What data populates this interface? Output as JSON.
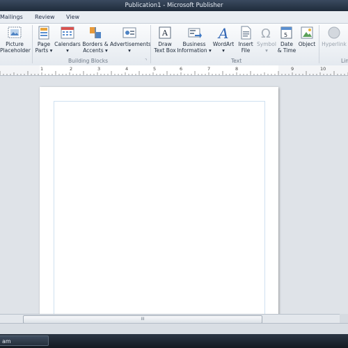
{
  "window": {
    "title": "Publication1 - Microsoft Publisher"
  },
  "tabs": [
    "Mailings",
    "Review",
    "View"
  ],
  "ribbon": {
    "picture_placeholder": [
      "Picture",
      "Placeholder"
    ],
    "page_parts": [
      "Page",
      "Parts ▾"
    ],
    "calendars": [
      "Calendars",
      "▾"
    ],
    "borders_accents": [
      "Borders &",
      "Accents ▾"
    ],
    "advertisements": [
      "Advertisements",
      "▾"
    ],
    "draw_text_box": [
      "Draw",
      "Text Box"
    ],
    "business_information": [
      "Business",
      "Information ▾"
    ],
    "wordart": [
      "WordArt",
      "▾"
    ],
    "insert_file": [
      "Insert",
      "File"
    ],
    "symbol": [
      "Symbol",
      "▾"
    ],
    "date_time": [
      "Date",
      "& Time"
    ],
    "object": [
      "Object"
    ],
    "hyperlink": [
      "Hyperlink"
    ],
    "groups": {
      "building_blocks": "Building Blocks",
      "text": "Text",
      "links": "Lin"
    },
    "launcher": "⌝"
  },
  "ruler": {
    "numbers": [
      "1",
      "2",
      "3",
      "4",
      "5",
      "6",
      "7",
      "8",
      "9",
      "10"
    ]
  },
  "scrollbar": {
    "grip": "III"
  },
  "taskbar": {
    "item": "am"
  },
  "colors": {
    "accent": "#1f5fb0",
    "ribbon_bg": "#f1f4f7",
    "canvas_bg": "#dfe3e8"
  }
}
